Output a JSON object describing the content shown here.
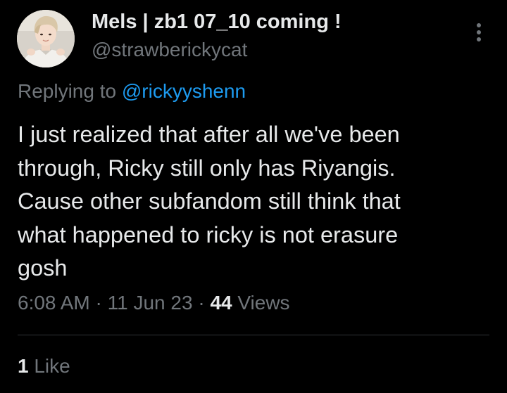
{
  "author": {
    "display_name": "Mels | zb1 07_10 coming !",
    "handle": "@strawberickycat"
  },
  "reply": {
    "prefix": "Replying to ",
    "mention": "@rickyyshenn"
  },
  "tweet": {
    "text": "I just realized that after all we've been\nthrough, Ricky still only has Riyangis.\nCause other subfandom still think that\nwhat happened to ricky is not erasure\ngosh"
  },
  "meta": {
    "time": "6:08 AM",
    "sep1": " · ",
    "date": "11 Jun 23",
    "sep2": " · ",
    "views_count": "44",
    "views_label": " Views"
  },
  "engagement": {
    "likes_count": "1",
    "likes_label": " Like"
  },
  "icons": {
    "more": "more-vertical-icon",
    "avatar": "profile-photo"
  },
  "colors": {
    "background": "#000000",
    "text_primary": "#e7e9ea",
    "text_secondary": "#71767b",
    "link": "#1d9bf0",
    "divider": "#2f3336"
  }
}
